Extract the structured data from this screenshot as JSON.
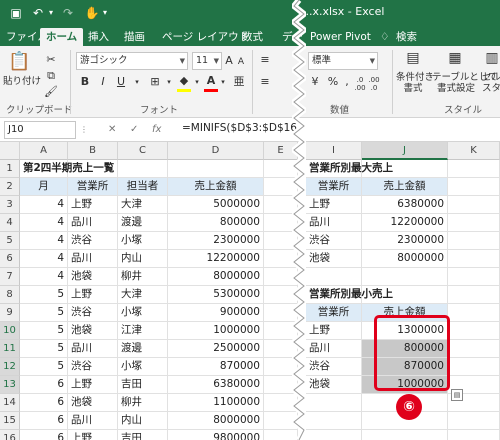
{
  "app": {
    "title_text": "...x.xlsx  -  Excel"
  },
  "tabs": [
    "ファイル",
    "ホーム",
    "挿入",
    "描画",
    "ページ レイアウト",
    "数式",
    "デー",
    "Power Pivot",
    "検索"
  ],
  "search_icon": "lightbulb-icon",
  "ribbon": {
    "paste_label": "貼り付け",
    "clipboard_label": "クリップボード",
    "font_name": "游ゴシック",
    "font_size": "11",
    "font_label": "フォント",
    "number_format": "標準",
    "number_label": "数値",
    "cond_format_label": "条件付き\n書式",
    "table_format_label": "テーブルとして\n書式設定",
    "cell_style_label": "セル\nスタ",
    "style_label": "スタイル",
    "bold": "B",
    "italic": "I",
    "underline": "U",
    "percent": "%",
    "comma": ",",
    "decimal_inc": ".0 .00",
    "decimal_dec": ".00 .0",
    "font_grow": "A",
    "font_shrink": "A",
    "fill_color": "#ffff00",
    "font_color": "#ff0000"
  },
  "formula_bar": {
    "name_box": "J10",
    "cancel": "✕",
    "confirm": "✓",
    "fx": "fx",
    "formula": "=MINIFS($D$3:$D$16,"
  },
  "columns_left": [
    "A",
    "B",
    "C",
    "D",
    "E"
  ],
  "columns_right": [
    "I",
    "J",
    "K"
  ],
  "selected_column": "J",
  "rows": [
    "1",
    "2",
    "3",
    "4",
    "5",
    "6",
    "7",
    "8",
    "9",
    "10",
    "11",
    "12",
    "13",
    "14",
    "15",
    "16"
  ],
  "selected_rows": [
    "10",
    "11",
    "12",
    "13"
  ],
  "left_table": {
    "title": "第2四半期売上一覧",
    "headers": [
      "月",
      "営業所",
      "担当者",
      "売上金額"
    ],
    "rows": [
      [
        "4",
        "上野",
        "大津",
        "5000000"
      ],
      [
        "4",
        "品川",
        "渡邊",
        "800000"
      ],
      [
        "4",
        "渋谷",
        "小塚",
        "2300000"
      ],
      [
        "4",
        "品川",
        "内山",
        "12200000"
      ],
      [
        "4",
        "池袋",
        "柳井",
        "8000000"
      ],
      [
        "5",
        "上野",
        "大津",
        "5300000"
      ],
      [
        "5",
        "渋谷",
        "小塚",
        "900000"
      ],
      [
        "5",
        "池袋",
        "江津",
        "1000000"
      ],
      [
        "5",
        "品川",
        "渡邊",
        "2500000"
      ],
      [
        "5",
        "渋谷",
        "小塚",
        "870000"
      ],
      [
        "6",
        "上野",
        "吉田",
        "6380000"
      ],
      [
        "6",
        "池袋",
        "柳井",
        "1100000"
      ],
      [
        "6",
        "品川",
        "内山",
        "8000000"
      ],
      [
        "6",
        "上野",
        "吉田",
        "9800000"
      ]
    ]
  },
  "max_table": {
    "title": "営業所別最大売上",
    "headers": [
      "営業所",
      "売上金額"
    ],
    "rows": [
      [
        "上野",
        "6380000"
      ],
      [
        "品川",
        "12200000"
      ],
      [
        "渋谷",
        "2300000"
      ],
      [
        "池袋",
        "8000000"
      ]
    ]
  },
  "min_table": {
    "title": "営業所別最小売上",
    "headers": [
      "営業所",
      "売上金額"
    ],
    "rows": [
      [
        "上野",
        "1300000"
      ],
      [
        "品川",
        "800000"
      ],
      [
        "渋谷",
        "870000"
      ],
      [
        "池袋",
        "1000000"
      ]
    ]
  },
  "step_badge": "⑥",
  "accent_color": "#217346",
  "highlight_color": "#e0001b"
}
